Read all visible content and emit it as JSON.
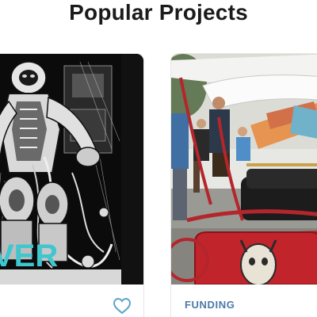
{
  "page": {
    "title": "Popular Projects"
  },
  "cards": [
    {
      "image_text": "VER",
      "favorite_icon": "heart-outline-icon"
    },
    {
      "category": "FUNDING"
    }
  ],
  "colors": {
    "accent": "#4b79a8",
    "heart": "#5aa5c6",
    "art_teal": "#3fc6cf"
  }
}
